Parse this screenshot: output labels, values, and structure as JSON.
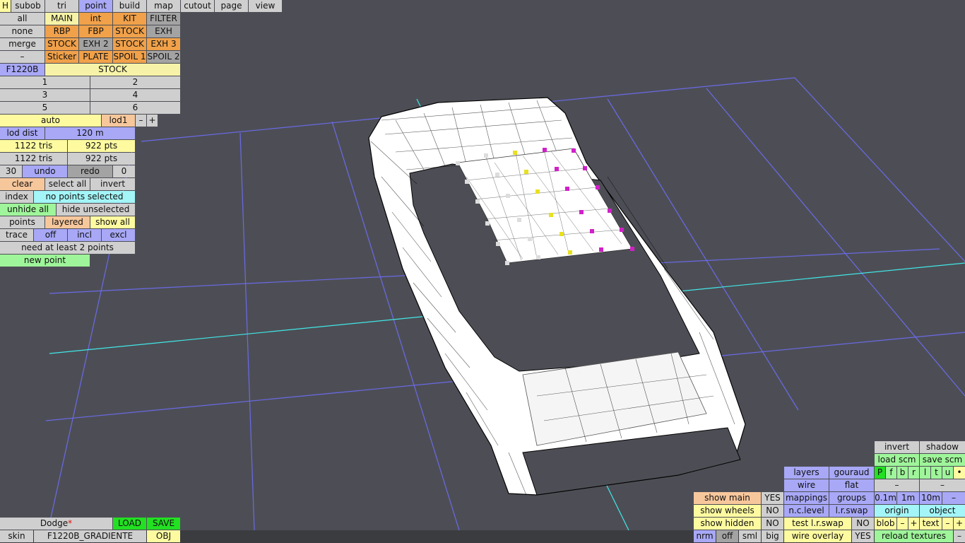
{
  "tabs": [
    "H",
    "subob",
    "tri",
    "point",
    "build",
    "map",
    "cutout",
    "page",
    "view"
  ],
  "row_select": [
    "all",
    "none",
    "merge",
    "–"
  ],
  "parts_grid": [
    [
      "MAIN",
      "int",
      "KIT",
      "FILTER"
    ],
    [
      "RBP",
      "FBP",
      "STOCK",
      "EXH"
    ],
    [
      "STOCK",
      "EXH 2",
      "STOCK",
      "EXH 3"
    ],
    [
      "Sticker",
      "PLATE",
      "SPOIL 1",
      "SPOIL 2"
    ]
  ],
  "car_code": "F1220B",
  "stock_label": "STOCK",
  "numbers": [
    "1",
    "2",
    "3",
    "4",
    "5",
    "6"
  ],
  "lod": {
    "auto": "auto",
    "level": "lod1",
    "minus": "–",
    "plus": "+",
    "dist_label": "lod dist",
    "dist_value": "120 m"
  },
  "stats": {
    "tris1": "1122 tris",
    "pts1": "922 pts",
    "tris2": "1122 tris",
    "pts2": "922 pts"
  },
  "history": {
    "count": "30",
    "undo": "undo",
    "redo": "redo",
    "redo_count": "0"
  },
  "selection": {
    "clear": "clear",
    "select_all": "select all",
    "invert": "invert",
    "index": "index",
    "status": "no points selected",
    "unhide_all": "unhide all",
    "hide_unselected": "hide unselected"
  },
  "points_row": {
    "points": "points",
    "layered": "layered",
    "show_all": "show all"
  },
  "trace_row": {
    "trace": "trace",
    "off": "off",
    "incl": "incl",
    "excl": "excl"
  },
  "message": "need at least 2 points",
  "new_point": "new point",
  "file": {
    "name": "Dodge",
    "modified_mark": "*",
    "load": "LOAD",
    "save": "SAVE",
    "skin_label": "skin",
    "skin_value": "F1220B_GRADIENTE",
    "obj": "OBJ"
  },
  "right_panel": {
    "invert": "invert",
    "shadow": "shadow",
    "load_scm": "load scm",
    "save_scm": "save scm",
    "flags": [
      "P",
      "f",
      "b",
      "r",
      "l",
      "t",
      "u",
      "•"
    ],
    "layers": "layers",
    "gouraud": "gouraud",
    "wire": "wire",
    "flat": "flat",
    "dash1": "–",
    "dash2": "–",
    "mappings": "mappings",
    "groups": "groups",
    "grid": [
      "0.1m",
      "1m",
      "10m",
      "–"
    ],
    "nc_level": "n.c.level",
    "lr_swap": "l.r.swap",
    "origin": "origin",
    "object": "object",
    "blob": "blob",
    "text": "text",
    "minus": "–",
    "plus": "+",
    "test_lr_swap": "test l.r.swap",
    "no": "NO",
    "wire_overlay": "wire overlay",
    "yes": "YES",
    "reload_textures": "reload textures",
    "show_main": "show main",
    "show_wheels": "show wheels",
    "show_hidden": "show hidden",
    "show_main_val": "YES",
    "show_wheels_val": "NO",
    "show_hidden_val": "NO",
    "view_modes": [
      "nrm",
      "off",
      "sml",
      "big"
    ]
  },
  "colors": {
    "background": "#4d4e55",
    "grid": "#6a6ae8",
    "axis": "#40e8e8",
    "mesh": "#ffffff",
    "wire": "#000000",
    "pt_white": "#dddddd",
    "pt_yellow": "#e8e020",
    "pt_magenta": "#d020c8"
  }
}
